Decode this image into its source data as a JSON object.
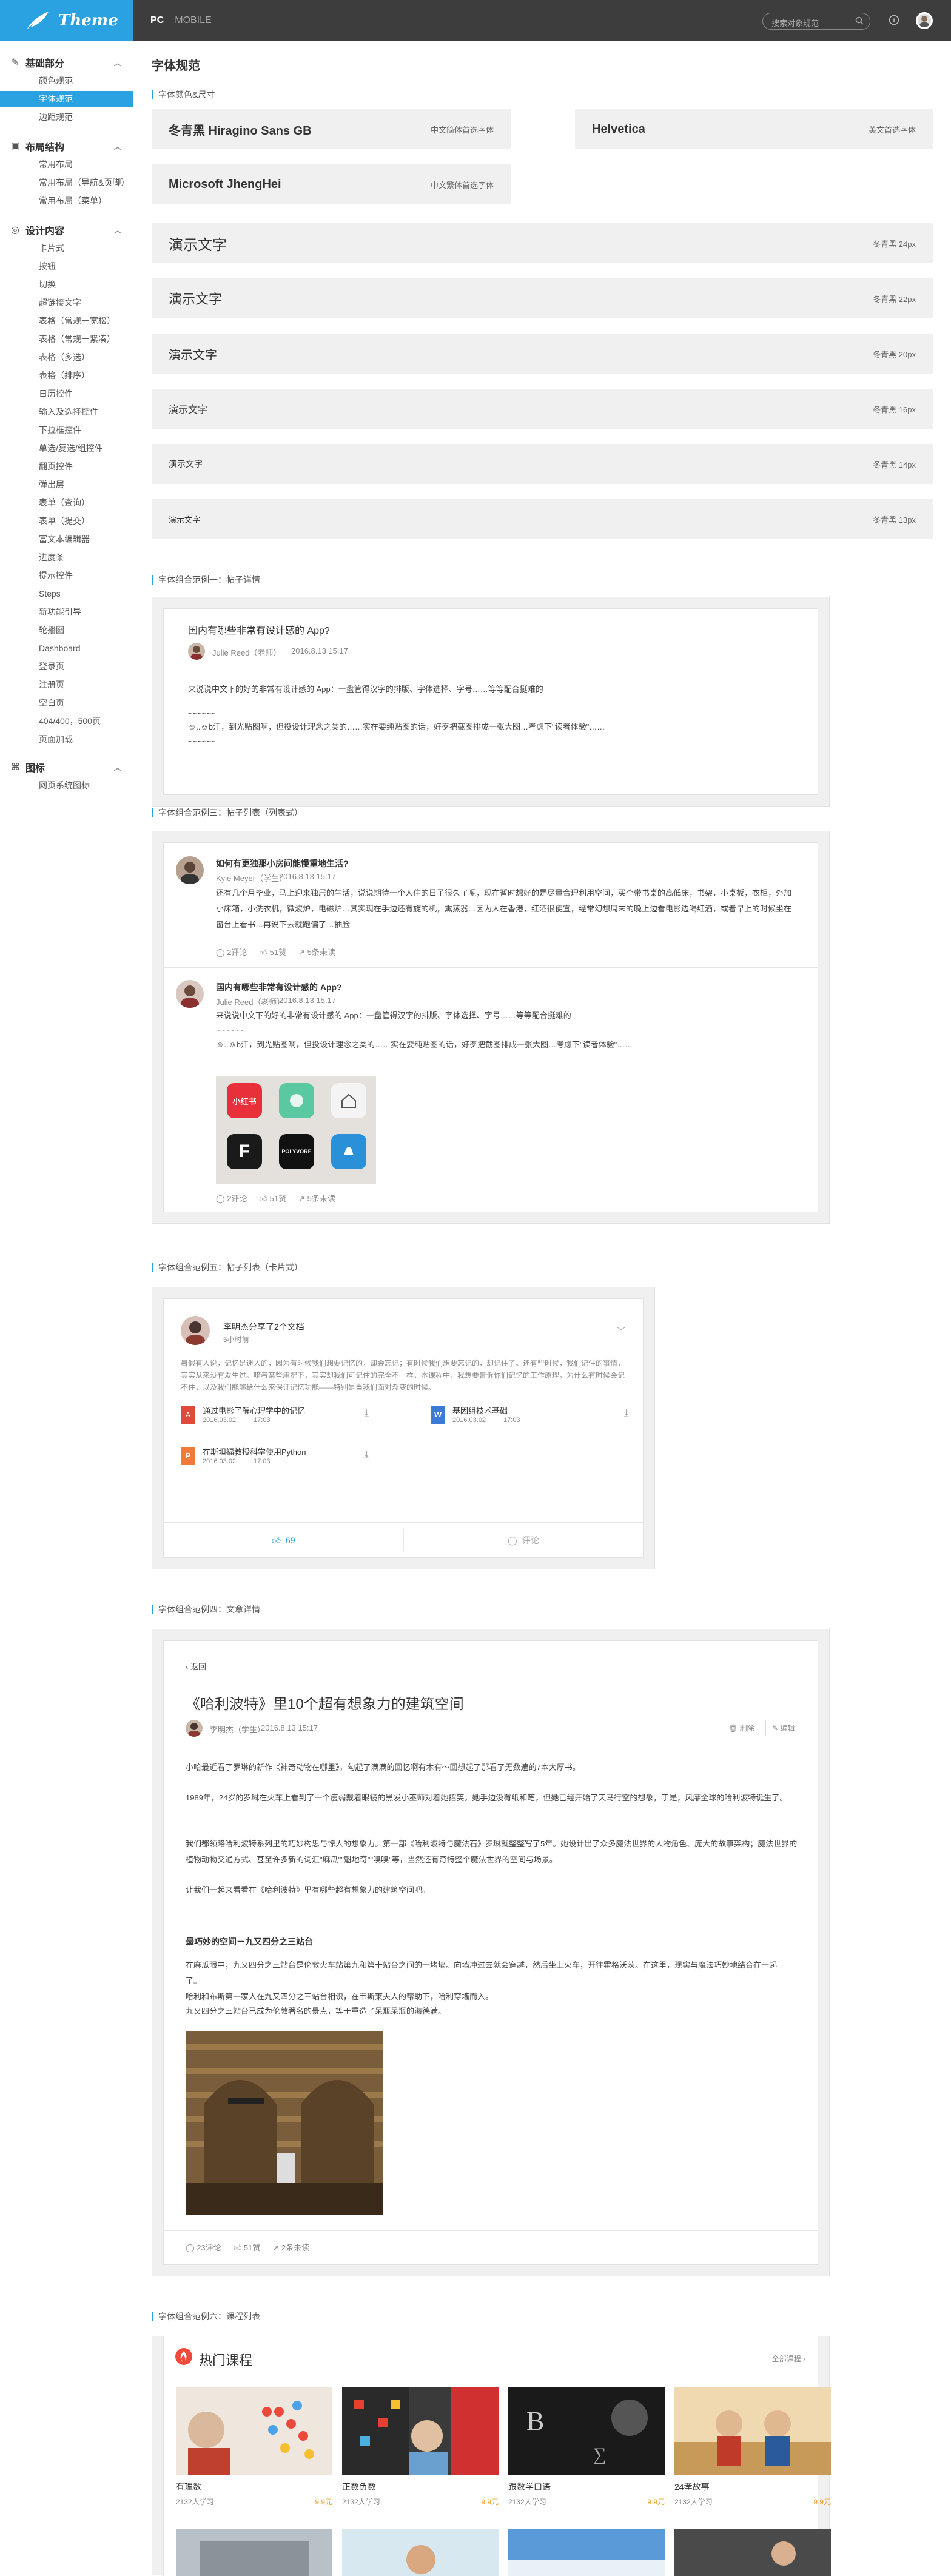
{
  "app": {
    "logo": "Theme"
  },
  "topnav": {
    "tabs": [
      "PC",
      "MOBILE"
    ],
    "search_placeholder": "搜索对象规范"
  },
  "sidebar": {
    "groups": [
      {
        "label": "基础部分",
        "items": [
          "颜色规范",
          "字体规范",
          "边距规范"
        ]
      },
      {
        "label": "布局结构",
        "items": [
          "常用布局",
          "常用布局（导航&页脚）",
          "常用布局（菜单）"
        ]
      },
      {
        "label": "设计内容",
        "items": [
          "卡片式",
          "按钮",
          "切换",
          "超链接文字",
          "表格（常规－宽松）",
          "表格（常规－紧凑）",
          "表格（多选）",
          "表格（排序）",
          "日历控件",
          "输入及选择控件",
          "下拉框控件",
          "单选/复选/组控件",
          "翻页控件",
          "弹出层",
          "表单（查询）",
          "表单（提交）",
          "富文本编辑器",
          "进度条",
          "提示控件",
          "Steps",
          "新功能引导",
          "轮播图",
          "Dashboard",
          "登录页",
          "注册页",
          "空白页",
          "404/400，500页",
          "页面加载"
        ]
      },
      {
        "label": "图标",
        "items": [
          "网页系统图标"
        ]
      }
    ]
  },
  "page": {
    "title": "字体规范",
    "sec_font": "字体颜色&尺寸",
    "fonts": [
      {
        "name": "冬青黑 Hiragino Sans GB",
        "desc": "中文简体首选字体"
      },
      {
        "name": "Helvetica",
        "desc": "英文首选字体"
      },
      {
        "name": "Microsoft JhengHei",
        "desc": "中文繁体首选字体"
      }
    ],
    "sizes": [
      {
        "sample": "演示文字",
        "desc": "冬青黑 24px"
      },
      {
        "sample": "演示文字",
        "desc": "冬青黑 22px"
      },
      {
        "sample": "演示文字",
        "desc": "冬青黑 20px"
      },
      {
        "sample": "演示文字",
        "desc": "冬青黑 16px"
      },
      {
        "sample": "演示文字",
        "desc": "冬青黑 14px"
      },
      {
        "sample": "演示文字",
        "desc": "冬青黑 13px"
      }
    ]
  },
  "ex1": {
    "section": "字体组合范例一：帖子详情",
    "title": "国内有哪些非常有设计感的 App?",
    "author": "Julie Reed（老师）",
    "date": "2016.8.13 15:17",
    "body": "来说说中文下的好的非常有设计感的 App：一盘管得汉字的排版、字体选择、字号……等等配合挺难的",
    "dash": "~~~~~~",
    "line2": "☺..☺b汗，到光贴图啊，但投设计理念之类的……实在要纯贴图的话，好歹把截图排成一张大图…考虑下\"读者体验\"……",
    "dash2": "~~~~~~"
  },
  "ex3": {
    "section": "字体组合范例三：帖子列表（列表式）",
    "p1": {
      "title": "如何有更独那小房间能慢重地生活?",
      "author": "Kyle Meyer（学生）",
      "date": "2016.8.13 15:17",
      "body": "还有几个月毕业，马上迎来独居的生活，说说期待一个人住的日子很久了呢，现在暂时想好的是尽量合理利用空间，买个带书桌的高低床，书架，小桌板，衣柜，外加小床箱，小洗衣机，微波炉，电磁炉…其实现在手边还有旋的机，熏蒸器…因为人在香港，红酒很便宜，经常幻想周末的晚上边看电影边喝红酒，或者早上的时候坐在窗台上看书…再说下去就跑偏了…抽脸",
      "comments": "2评论",
      "likes": "51赞",
      "shares": "5条未读"
    },
    "p2": {
      "title": "国内有哪些非常有设计感的 App?",
      "author": "Julie Reed（老师）",
      "date": "2016.8.13 15:17",
      "body": "来说说中文下的好的非常有设计感的 App：一盘管得汉字的排版、字体选择、字号……等等配合挺难的",
      "dash": "~~~~~~",
      "line2": "☺..☺b汗，到光贴图啊，但投设计理念之类的……实在要纯贴图的话，好歹把截图排成一张大图…考虑下\"读者体验\"……",
      "apps": [
        "小红书",
        "",
        "",
        "",
        "POLYVORE",
        ""
      ],
      "comments": "2评论",
      "likes": "51赞",
      "shares": "5条未读"
    }
  },
  "ex5": {
    "section": "字体组合范例五：帖子列表（卡片式）",
    "user": "李明杰分享了2个文档",
    "time": "5小时前",
    "body": "暑假有人说，记忆是迷人的，因为有时候我们想要记忆的，却会忘记；有时候我们想要忘记的，却记住了。还有些时候，我们记住的事情，其实从来没有发生过。喏者某些用况下，其实却我们可记住的完全不一样，本课程中，我想要告诉你们记忆的工作原理，为什么有时候会记不住，以及我们能够给什么来保证记忆功能——特别是当我们面对渐变的时候。",
    "files": [
      {
        "name": "通过电影了解心理学中的记忆",
        "date": "2016.03.02",
        "time": "17:03"
      },
      {
        "name": "基因组技术基础",
        "date": "2016.03.02",
        "time": "17:03"
      },
      {
        "name": "在斯坦福教授科学使用Python",
        "date": "2016.03.02",
        "time": "17:03"
      }
    ],
    "likes": "69",
    "comment": "评论"
  },
  "ex4": {
    "section": "字体组合范例四：文章详情",
    "back": "返回",
    "title": "《哈利波特》里10个超有想象力的建筑空间",
    "author": "李明杰（学生）",
    "date": "2016.8.13 15:17",
    "delete": "删除",
    "edit": "编辑",
    "paras": [
      "小哈最近看了罗琳的新作《神奇动物在哪里》，勾起了满满的回忆啊有木有～回想起了那看了无数遍的7本大厚书。",
      "1989年，24岁的罗琳在火车上看到了一个瘦弱戴着眼镜的黑发小巫师对着她招笑。她手边没有纸和笔，但她已经开始了天马行空的想象，于是，风靡全球的哈利波特诞生了。",
      "我们都领略哈利波特系列里的巧妙构思与惊人的想象力。第一部《哈利波特与魔法石》罗琳就整整写了5年。她设计出了众多魔法世界的人物角色、庞大的故事架构；魔法世界的植物动物交通方式、甚至许多新的词汇\"麻瓜\"\"魁地奇\"\"嗅嗅\"等，当然还有奇特整个魔法世界的空间与场景。",
      "让我们一起来看看在《哈利波特》里有哪些超有想象力的建筑空间吧。"
    ],
    "subtitle": "最巧妙的空间－九又四分之三站台",
    "sub_paras": [
      "在麻瓜眼中，九又四分之三站台是伦敦火车站第九和第十站台之间的一堵墙。向墙冲过去就会穿越，然后坐上火车，开往霍格沃茨。在这里，现实与魔法巧妙地结合在一起了。",
      "哈利和布斯第一家人在九又四分之三站台相识，在韦斯莱夫人的帮助下，哈利穿墙而入。",
      "九又四分之三站台已成为伦敦著名的景点，等于重造了呆瓶呆瓶的海德满。"
    ],
    "comments": "23评论",
    "likes": "51赞",
    "shares": "2条未读"
  },
  "ex6": {
    "section": "字体组合范例六：课程列表",
    "title": "热门课程",
    "all": "全部课程 ›",
    "courses": [
      {
        "name": "有理数",
        "learners": "2132人学习",
        "price": "9.9元"
      },
      {
        "name": "正数负数",
        "learners": "2132人学习",
        "price": "9.9元"
      },
      {
        "name": "跟数学口语",
        "learners": "2132人学习",
        "price": "9.9元"
      },
      {
        "name": "24孝故事",
        "learners": "2132人学习",
        "price": "9.9元"
      }
    ]
  },
  "colors": {
    "accent": "#2aa2e2",
    "topbar": "#3d3d3d"
  }
}
